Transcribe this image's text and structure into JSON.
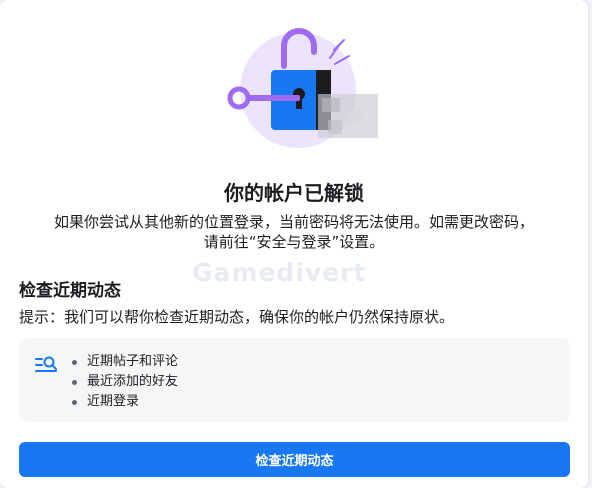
{
  "colors": {
    "accent": "#1877f2",
    "lock_body": "#1877f2",
    "lock_shackle": "#9f6bf0",
    "halo": "#ece4fd",
    "panel_bg": "#f5f6f7"
  },
  "dialog": {
    "title": "你的帐户已解锁",
    "description_line1": "如果你尝试从其他新的位置登录，当前密码将无法使用。如需更改密码，",
    "description_line2": "请前往“安全与登录”设置。",
    "illustration_icon": "unlocked-padlock-with-key"
  },
  "review": {
    "section_title": "检查近期动态",
    "hint": "提示：我们可以帮你检查近期动态，确保你的帐户仍然保持原状。",
    "list_icon": "list-search-icon",
    "items": [
      "近期帖子和评论",
      "最近添加的好友",
      "近期登录"
    ],
    "button_label": "检查近期动态"
  },
  "watermark": "Gamedivert"
}
